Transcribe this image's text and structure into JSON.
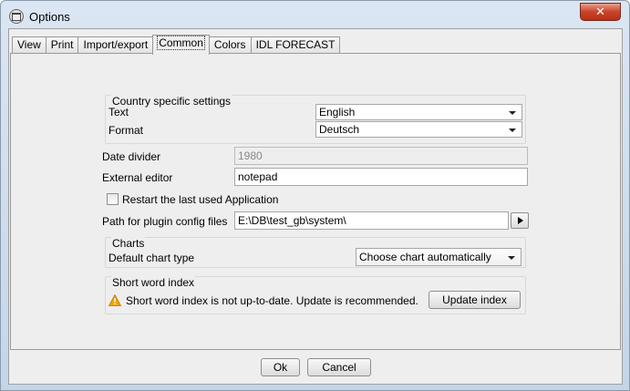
{
  "window": {
    "title": "Options",
    "close_glyph": "✕"
  },
  "tabs": [
    {
      "label": "View"
    },
    {
      "label": "Print"
    },
    {
      "label": "Import/export"
    },
    {
      "label": "Common",
      "active": true
    },
    {
      "label": "Colors"
    },
    {
      "label": "IDL FORECAST"
    }
  ],
  "country": {
    "title": "Country specific settings",
    "text_label": "Text",
    "text_value": "English",
    "format_label": "Format",
    "format_value": "Deutsch"
  },
  "date_divider": {
    "label": "Date divider",
    "value": "1980"
  },
  "external_editor": {
    "label": "External editor",
    "value": "notepad"
  },
  "restart": {
    "label": "Restart the last used Application",
    "checked": false
  },
  "plugin_path": {
    "label": "Path for plugin config files",
    "value": "E:\\DB\\test_gb\\system\\"
  },
  "charts": {
    "title": "Charts",
    "default_label": "Default chart type",
    "default_value": "Choose chart automatically"
  },
  "short_word": {
    "title": "Short word index",
    "message": "Short word index is not up-to-date. Update is recommended.",
    "update_label": "Update index"
  },
  "footer": {
    "ok_label": "Ok",
    "cancel_label": "Cancel"
  },
  "icons": [
    "window-app-icon",
    "close-icon",
    "combo-arrow-icon",
    "play-arrow-icon",
    "warning-icon"
  ],
  "colors": {
    "close": "#c7432a",
    "warning": "#f0a500"
  }
}
